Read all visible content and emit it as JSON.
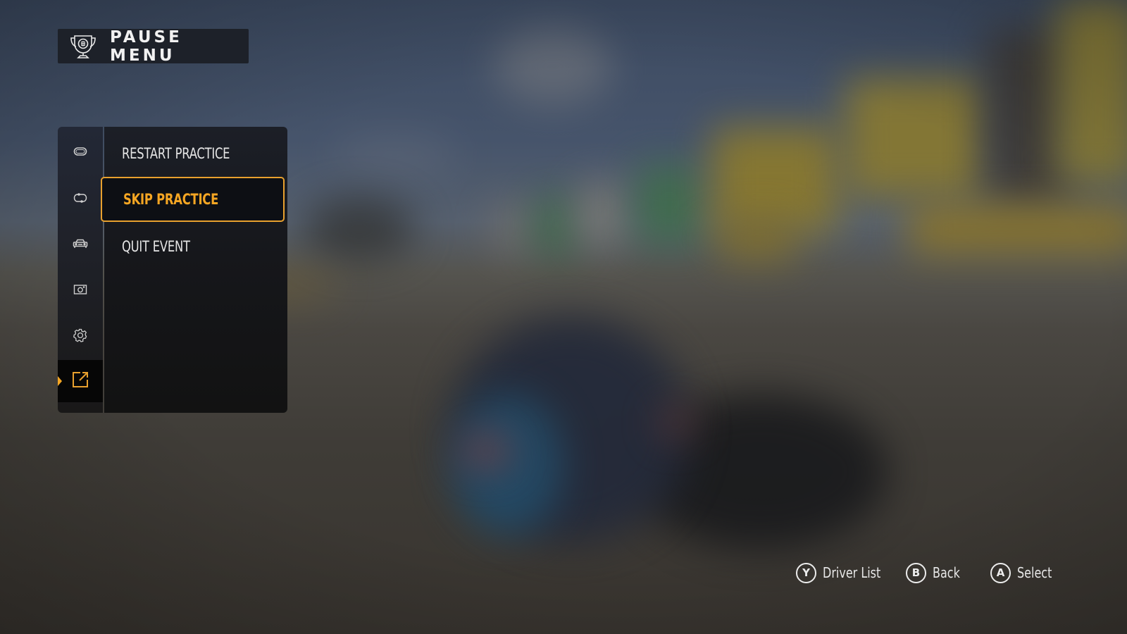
{
  "header": {
    "title": "PAUSE MENU",
    "icon": "trophy-icon"
  },
  "rail": {
    "items": [
      {
        "icon": "track-oval-icon",
        "active": false
      },
      {
        "icon": "restart-loop-icon",
        "active": false
      },
      {
        "icon": "car-icon",
        "active": false
      },
      {
        "icon": "camera-icon",
        "active": false
      },
      {
        "icon": "gear-icon",
        "active": false
      },
      {
        "icon": "exit-icon",
        "active": true
      }
    ]
  },
  "menu": {
    "items": [
      {
        "label": "RESTART PRACTICE",
        "selected": false
      },
      {
        "label": "SKIP PRACTICE",
        "selected": true
      },
      {
        "label": "QUIT EVENT",
        "selected": false
      }
    ]
  },
  "prompts": [
    {
      "button": "Y",
      "label": "Driver List"
    },
    {
      "button": "B",
      "label": "Back"
    },
    {
      "button": "A",
      "label": "Select"
    }
  ],
  "colors": {
    "accent": "#f5a623",
    "panel": "#16171b",
    "header": "#1d2129",
    "text": "#e6e6e6"
  }
}
